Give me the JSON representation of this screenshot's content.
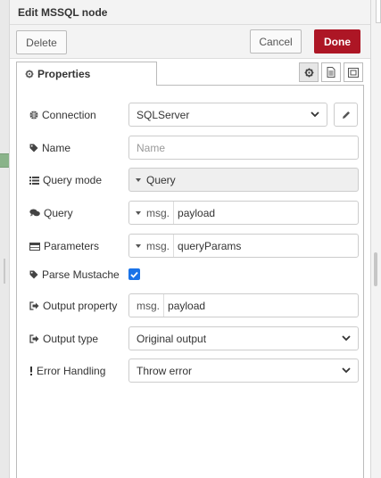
{
  "header": {
    "title": "Edit MSSQL node"
  },
  "toolbar": {
    "delete_label": "Delete",
    "cancel_label": "Cancel",
    "done_label": "Done"
  },
  "tabs": {
    "properties_label": "Properties"
  },
  "form": {
    "connection": {
      "label": "Connection",
      "value": "SQLServer"
    },
    "name": {
      "label": "Name",
      "placeholder": "Name"
    },
    "query_mode": {
      "label": "Query mode",
      "value": "Query"
    },
    "query": {
      "label": "Query",
      "prefix": "msg.",
      "value": "payload"
    },
    "parameters": {
      "label": "Parameters",
      "prefix": "msg.",
      "value": "queryParams"
    },
    "parse_mustache": {
      "label": "Parse Mustache",
      "checked": true
    },
    "output_property": {
      "label": "Output property",
      "prefix": "msg.",
      "value": "payload"
    },
    "output_type": {
      "label": "Output type",
      "value": "Original output"
    },
    "error_handling": {
      "label": "Error Handling",
      "value": "Throw error"
    }
  },
  "colors": {
    "done_button": "#ad1625",
    "checkbox": "#1a73e8"
  }
}
